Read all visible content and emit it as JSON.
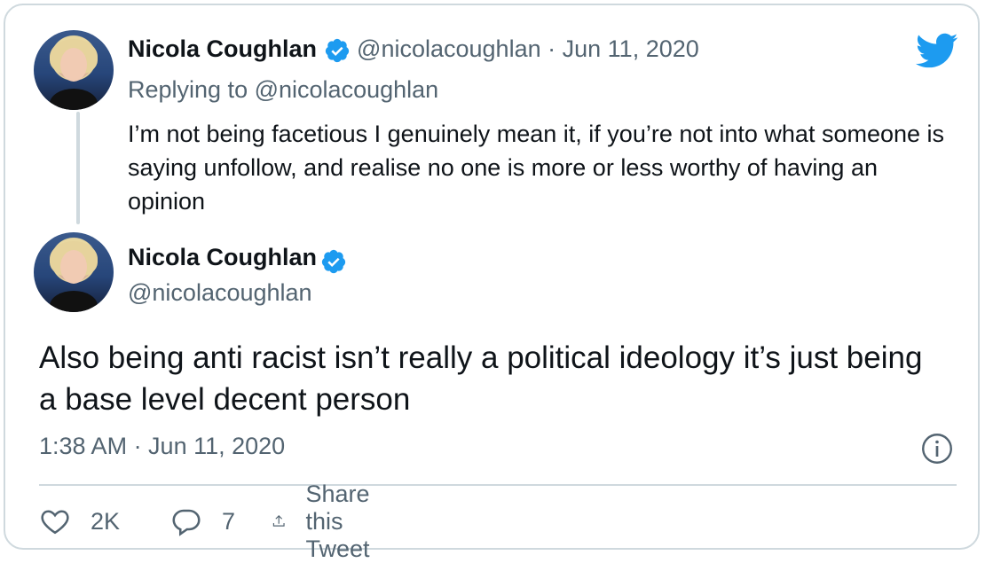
{
  "original_tweet": {
    "name": "Nicola Coughlan",
    "handle": "@nicolacoughlan",
    "separator": "·",
    "date": "Jun 11, 2020",
    "replying_prefix": "Replying to",
    "replying_to": "@nicolacoughlan",
    "text": "I’m not being facetious I genuinely mean it, if you’re not into what someone is saying unfollow, and realise no one is more or less worthy of having an opinion"
  },
  "main_tweet": {
    "name": "Nicola Coughlan",
    "handle": "@nicolacoughlan",
    "text": "Also being anti racist isn’t really a political ideology it’s just being a base level decent person",
    "timestamp": "1:38 AM · Jun 11, 2020"
  },
  "actions": {
    "likes": "2K",
    "replies": "7",
    "share_label": "Share this Tweet"
  },
  "colors": {
    "twitter_blue": "#1d9bf0",
    "text": "#0f1419",
    "muted": "#536471",
    "border": "#cfd9de"
  },
  "icons": [
    "verified-badge-icon",
    "twitter-bird-icon",
    "info-icon",
    "heart-icon",
    "reply-icon",
    "share-icon"
  ]
}
